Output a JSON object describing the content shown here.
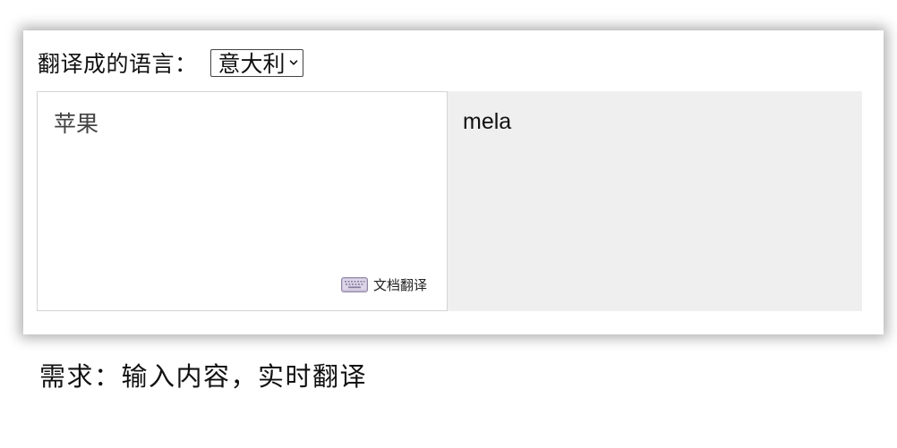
{
  "translator": {
    "target_language_label": "翻译成的语言：",
    "target_language_value": "意大利",
    "source_text": "苹果",
    "doc_translate_label": "文档翻译",
    "translated_text": "mela"
  },
  "caption": "需求：输入内容，实时翻译",
  "icons": {
    "dropdown": "chevron-down-icon",
    "keyboard": "keyboard-icon"
  },
  "colors": {
    "target_panel_bg": "#efefef",
    "border": "#d4d4d4"
  }
}
